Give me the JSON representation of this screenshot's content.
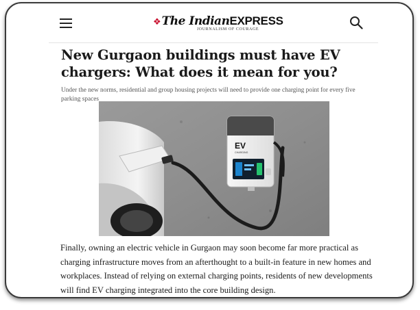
{
  "header": {
    "logo_the": "The Indian",
    "logo_express": "EXPRESS",
    "logo_tagline": "JOURNALISM OF COURAGE"
  },
  "article": {
    "headline": "New Gurgaon buildings must have EV chargers: What does it mean for you?",
    "subheadline": "Under the new norms, residential and group housing projects will need to provide one charging point for every five parking spaces",
    "image": {
      "charger_badge": "EV",
      "charger_sublabel": "CHARGING"
    },
    "body": "Finally, owning an electric vehicle in Gurgaon may soon become far more practical as charging infrastructure moves from an afterthought to a built-in feature in new homes and workplaces. Instead of relying on external charging points, residents of new developments will find EV charging integrated into the core building design."
  },
  "icons": {
    "menu": "hamburger-menu-icon",
    "search": "search-icon",
    "logo_mark": "flame-icon"
  },
  "colors": {
    "brand_red": "#c8102e",
    "text": "#1a1a1a",
    "frame": "#3a3a3a"
  }
}
